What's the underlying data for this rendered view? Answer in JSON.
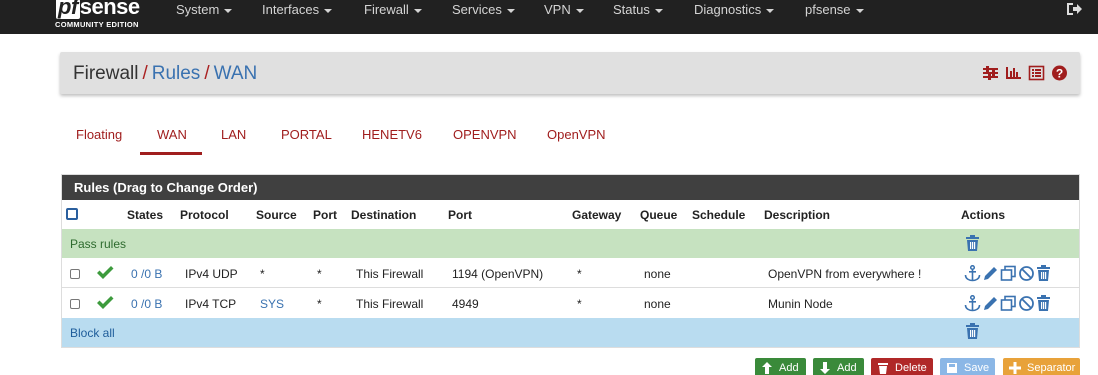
{
  "brand": {
    "name_prefix": "pf",
    "name_suffix": "sense",
    "edition": "COMMUNITY EDITION"
  },
  "nav": {
    "items": [
      {
        "label": "System"
      },
      {
        "label": "Interfaces"
      },
      {
        "label": "Firewall"
      },
      {
        "label": "Services"
      },
      {
        "label": "VPN"
      },
      {
        "label": "Status"
      },
      {
        "label": "Diagnostics"
      },
      {
        "label": "pfsense"
      }
    ],
    "logout_icon": "sign-out-icon"
  },
  "breadcrumb": {
    "root": "Firewall",
    "separator": "/",
    "level1": "Rules",
    "level2": "WAN",
    "icons": [
      "sliders-icon",
      "bar-chart-icon",
      "list-icon",
      "help-icon"
    ]
  },
  "tabs": {
    "active": "WAN",
    "items": [
      {
        "label": "Floating"
      },
      {
        "label": "WAN"
      },
      {
        "label": "LAN"
      },
      {
        "label": "PORTAL"
      },
      {
        "label": "HENETV6"
      },
      {
        "label": "OPENVPN"
      },
      {
        "label": "OpenVPN"
      }
    ]
  },
  "rules_panel": {
    "title": "Rules (Drag to Change Order)",
    "headers": {
      "states": "States",
      "protocol": "Protocol",
      "source": "Source",
      "src_port": "Port",
      "destination": "Destination",
      "dst_port": "Port",
      "gateway": "Gateway",
      "queue": "Queue",
      "schedule": "Schedule",
      "description": "Description",
      "actions": "Actions"
    },
    "pass_separator": "Pass rules",
    "block_separator": "Block all",
    "rows": [
      {
        "states": "0 /0 B",
        "protocol": "IPv4 UDP",
        "source": "*",
        "src_port": "*",
        "destination": "This Firewall",
        "dst_port": "1194 (OpenVPN)",
        "gateway": "*",
        "queue": "none",
        "schedule": "",
        "description": "OpenVPN from everywhere !"
      },
      {
        "states": "0 /0 B",
        "protocol": "IPv4 TCP",
        "source": "SYS",
        "src_port": "*",
        "destination": "This Firewall",
        "dst_port": "4949",
        "gateway": "*",
        "queue": "none",
        "schedule": "",
        "description": "Munin Node"
      }
    ]
  },
  "buttons": {
    "add_top": "Add",
    "add_bottom": "Add",
    "delete": "Delete",
    "save": "Save",
    "separator": "Separator"
  },
  "colors": {
    "navbar": "#212121",
    "accent_red": "#a01e1e",
    "link_blue": "#3a72b0",
    "pass_row": "#c6e2c0",
    "block_row": "#b9dcf0"
  }
}
